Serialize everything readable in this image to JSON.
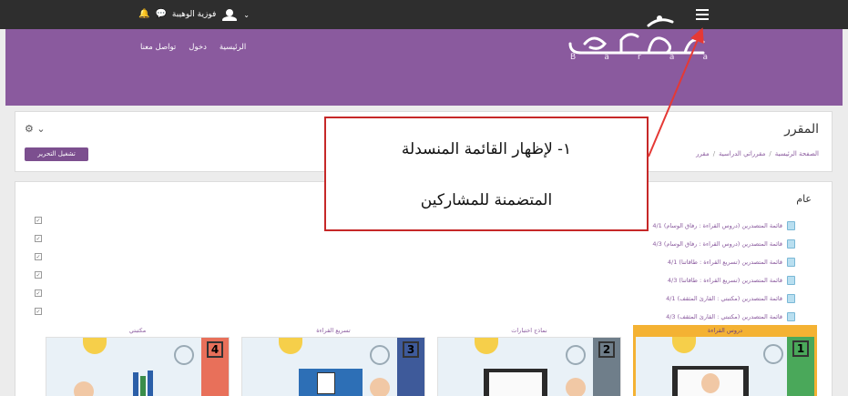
{
  "topbar": {
    "user_name": "فوزية الوهيبة",
    "icons": [
      "bell-icon",
      "chat-icon",
      "user-avatar",
      "chevron-down-icon",
      "menu-icon"
    ]
  },
  "header": {
    "nav": [
      "الرئيسية",
      "دخول",
      "تواصل معنا"
    ],
    "logo_letters": [
      "B",
      "a",
      "r",
      "a",
      "a"
    ],
    "colors": {
      "purple": "#8a5a9e",
      "topbar": "#2e2e2e"
    }
  },
  "course": {
    "title": "المقرر",
    "breadcrumb": [
      "الصفحة الرئيسية",
      "مقرراتي الدراسية",
      "مقرر"
    ],
    "edit_button": "تشغيل التحرير"
  },
  "section": {
    "title": "عام",
    "activities": [
      "قائمة المتصدرين (دروس القراءة : رفاق الوسام) 4/1",
      "قائمة المتصدرين (دروس القراءة : رفاق الوسام) 4/3",
      "قائمة المتصدرين (تسريع القراءة : طاقاتنا) 4/1",
      "قائمة المتصدرين (تسريع القراءة : طاقاتنا) 4/3",
      "قائمة المتصدرين (مكتبتي : القارئ المثقف) 4/1",
      "قائمة المتصدرين (مكتبتي : القارئ المثقف) 4/3"
    ],
    "tiles": [
      {
        "label": "مكتبتي",
        "number": "4"
      },
      {
        "label": "تسريع القراءة",
        "number": "3"
      },
      {
        "label": "نماذج اختبارات",
        "number": "2"
      },
      {
        "label": "دروس القراءة",
        "number": "1"
      }
    ]
  },
  "annotation": {
    "line1": "١- لإظهار القائمة المنسدلة",
    "line2": "المتضمنة للمشاركين",
    "color": "#c62828"
  }
}
